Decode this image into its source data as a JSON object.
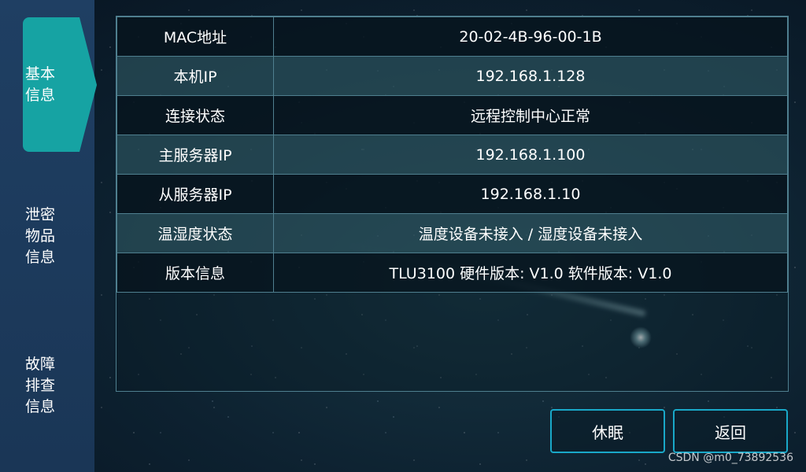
{
  "sidebar": {
    "items": [
      {
        "lines": [
          "基本",
          "信息"
        ],
        "active": true
      },
      {
        "lines": [
          "泄密",
          "物品",
          "信息"
        ],
        "active": false
      },
      {
        "lines": [
          "故障",
          "排查",
          "信息"
        ],
        "active": false
      }
    ]
  },
  "info_rows": [
    {
      "label": "MAC地址",
      "value": "20-02-4B-96-00-1B"
    },
    {
      "label": "本机IP",
      "value": "192.168.1.128"
    },
    {
      "label": "连接状态",
      "value": "远程控制中心正常"
    },
    {
      "label": "主服务器IP",
      "value": "192.168.1.100"
    },
    {
      "label": "从服务器IP",
      "value": "192.168.1.10"
    },
    {
      "label": "温湿度状态",
      "value": "温度设备未接入 / 湿度设备未接入"
    },
    {
      "label": "版本信息",
      "value": "TLU3100  硬件版本: V1.0  软件版本: V1.0"
    }
  ],
  "buttons": {
    "sleep": "休眠",
    "back": "返回"
  },
  "watermark": "CSDN @m0_73892536",
  "colors": {
    "active_tab": "#16a3a3",
    "sidebar_bg": "#1f3f63",
    "button_border": "#19a8c8",
    "table_border": "#4f7f8f"
  }
}
